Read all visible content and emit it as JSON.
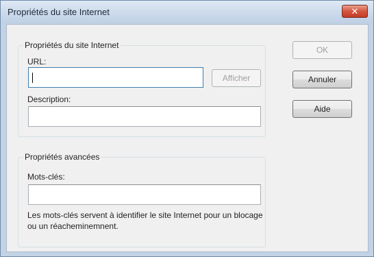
{
  "window": {
    "title": "Propriétés du site Internet",
    "close_symbol": "✕",
    "close_icon": "close-icon"
  },
  "site_group": {
    "legend": "Propriétés du site Internet",
    "url_label": "URL:",
    "url_value": "",
    "show_button": "Afficher",
    "description_label": "Description:",
    "description_value": ""
  },
  "advanced_group": {
    "legend": "Propriétés avancées",
    "keywords_label": "Mots-clés:",
    "keywords_value": "",
    "help_text": "Les mots-clés servent à identifier le site Internet pour un blocage ou un réacheminemnent."
  },
  "buttons": {
    "ok": "OK",
    "cancel": "Annuler",
    "help": "Aide"
  },
  "colors": {
    "frame": "#c3d3e6",
    "client": "#f0f0f0",
    "close_button": "#c23c26",
    "focus_border": "#3d7bad"
  }
}
